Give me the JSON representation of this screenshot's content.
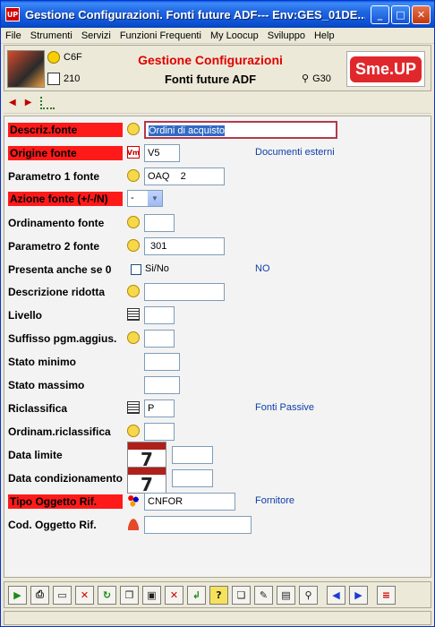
{
  "window": {
    "title": "Gestione Configurazioni. Fonti future ADF--- Env:GES_01DE...",
    "icon_label": "UP"
  },
  "menu": [
    "File",
    "Strumenti",
    "Servizi",
    "Funzioni Frequenti",
    "My Loocup",
    "Sviluppo",
    "Help"
  ],
  "header": {
    "code1": "C6F",
    "code2": "210",
    "code3": "G30",
    "title": "Gestione Configurazioni",
    "subtitle": "Fonti future ADF",
    "brand": "Sme.UP"
  },
  "form": {
    "descriz_fonte": {
      "label": "Descriz.fonte",
      "value": "Ordini di acquisto"
    },
    "origine_fonte": {
      "label": "Origine fonte",
      "value": "V5",
      "desc": "Documenti esterni"
    },
    "parametro1": {
      "label": "Parametro 1 fonte",
      "value": "OAQ    2"
    },
    "azione_fonte": {
      "label": "Azione fonte (+/-/N)",
      "value": "-"
    },
    "ordinamento": {
      "label": "Ordinamento fonte",
      "value": ""
    },
    "parametro2": {
      "label": "Parametro 2 fonte",
      "value": " 301"
    },
    "presenta": {
      "label": "Presenta anche se 0",
      "checkbox_label": "Si/No",
      "desc": "NO"
    },
    "descrizione_ridotta": {
      "label": "Descrizione ridotta",
      "value": ""
    },
    "livello": {
      "label": "Livello",
      "value": ""
    },
    "suffisso": {
      "label": "Suffisso pgm.aggius.",
      "value": ""
    },
    "stato_minimo": {
      "label": "Stato minimo",
      "value": ""
    },
    "stato_massimo": {
      "label": "Stato massimo",
      "value": ""
    },
    "riclassifica": {
      "label": "Riclassifica",
      "value": "P",
      "desc": "Fonti Passive"
    },
    "ordinam_riclassifica": {
      "label": "Ordinam.riclassifica",
      "value": ""
    },
    "data_limite": {
      "label": "Data limite",
      "value": "",
      "cal_day": "7"
    },
    "data_condizionamento": {
      "label": "Data condizionamento",
      "value": "",
      "cal_day": "7"
    },
    "tipo_oggetto": {
      "label": "Tipo Oggetto Rif.",
      "value": "CNFOR",
      "desc": "Fornitore"
    },
    "cod_oggetto": {
      "label": "Cod. Oggetto Rif.",
      "value": ""
    }
  }
}
